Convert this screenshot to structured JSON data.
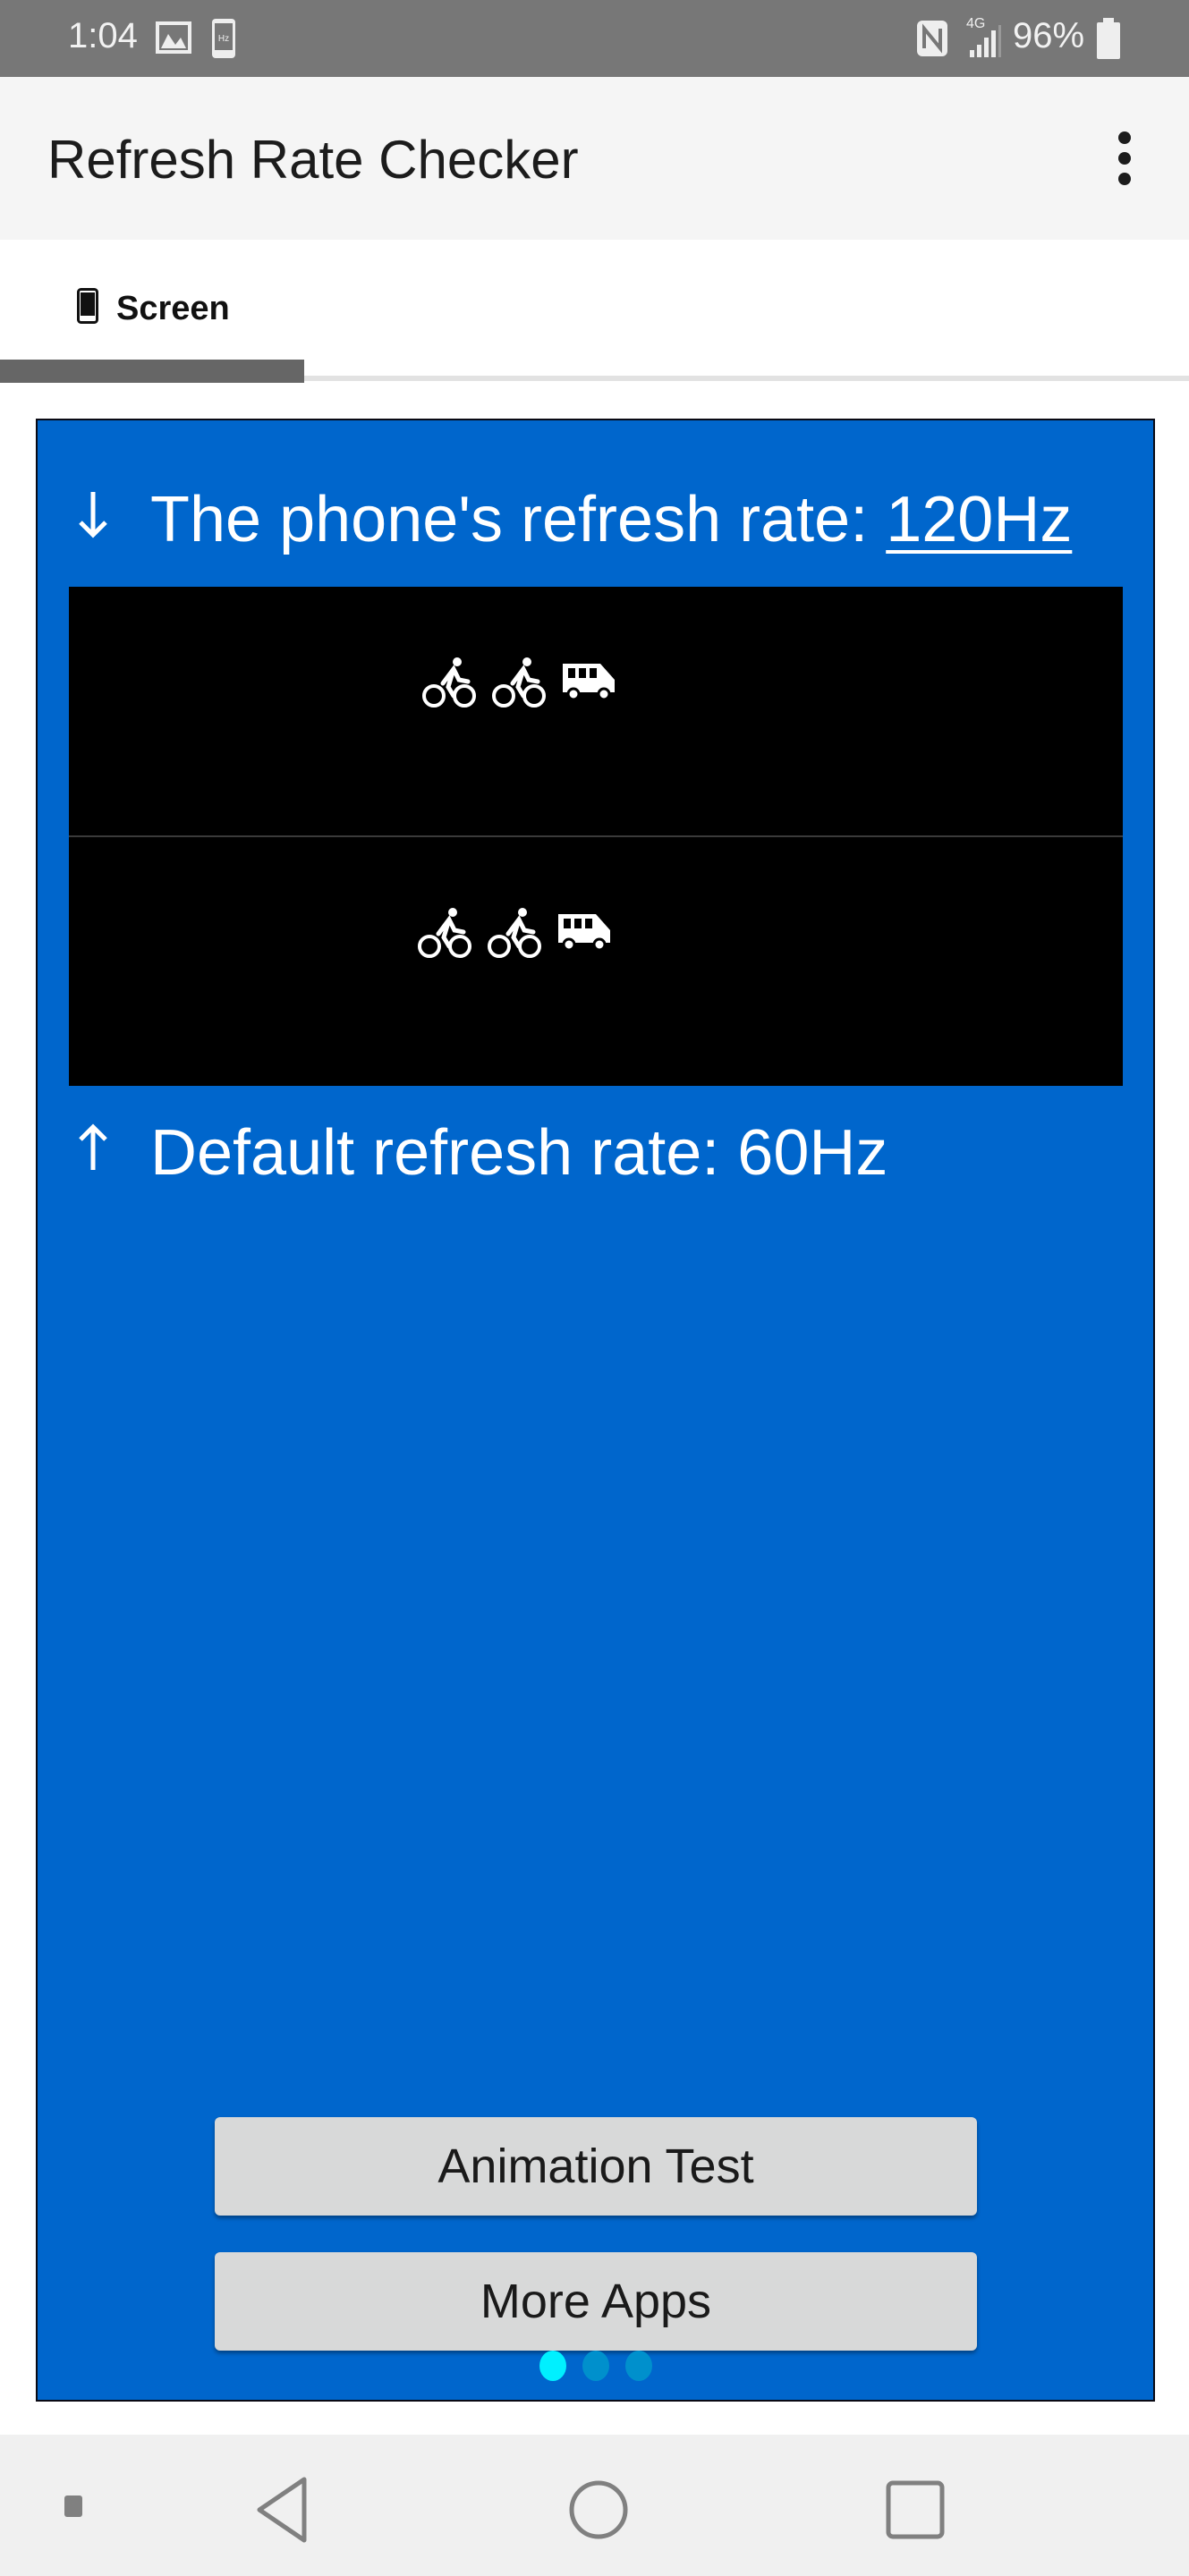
{
  "status_bar": {
    "time": "1:04",
    "left_icons": [
      "image-icon",
      "hz-phone-icon"
    ],
    "right_icons": [
      "nfc-icon",
      "signal-4g-icon",
      "battery-icon"
    ],
    "network": "4G",
    "battery": "96%"
  },
  "app_bar": {
    "title": "Refresh Rate Checker",
    "menu_icon": "more-vert-icon"
  },
  "tabs": [
    {
      "label": "Screen",
      "icon": "phone-icon",
      "selected": true
    }
  ],
  "panel": {
    "phone_rate_label": "The phone's refresh rate: ",
    "phone_rate_value": "120Hz",
    "phone_rate_icon": "arrow-down-icon",
    "default_rate_label": "Default refresh rate: 60Hz",
    "default_rate_icon": "arrow-up-icon",
    "animation_rows": [
      {
        "icons": [
          "bicycle-icon",
          "bicycle-icon",
          "van-icon"
        ]
      },
      {
        "icons": [
          "bicycle-icon",
          "bicycle-icon",
          "van-icon"
        ]
      }
    ],
    "buttons": {
      "animation_test": "Animation Test",
      "more_apps": "More Apps"
    },
    "page_indicator": {
      "total": 3,
      "active": 0
    }
  },
  "colors": {
    "panel_bg": "#0066cc",
    "dot_active": "#00f0ff",
    "dot_inactive": "#0090cc"
  },
  "nav_bar": [
    "indicator",
    "back",
    "home",
    "recents"
  ]
}
